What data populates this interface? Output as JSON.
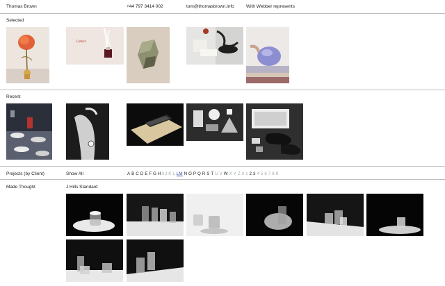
{
  "header": {
    "name": "Thomas Brown",
    "phone": "+44 797 3414 002",
    "email": "tom@thomasbrown.info",
    "rep": "With Webber represents"
  },
  "sections": {
    "selected": "Selected",
    "recent": "Recent",
    "projects": "Projects (by Client)",
    "show_all": "Show All",
    "client": "Made Thought",
    "project": "J Hills Standard"
  },
  "alphabet": {
    "active": [
      "A",
      "B",
      "C",
      "D",
      "E",
      "F",
      "G",
      "H",
      "I"
    ],
    "dim1": [
      "J",
      "K",
      "L"
    ],
    "underlined": "LM",
    "active2": [
      "N",
      "O",
      "P",
      "Q",
      "R",
      "S",
      "T"
    ],
    "dim2": [
      "U",
      "V"
    ],
    "active3": [
      "W"
    ],
    "dim3": [
      "X",
      "Y",
      "Z"
    ],
    "dim4": [
      "0",
      "1"
    ],
    "digits_dark": [
      "2",
      "3"
    ],
    "digits_dim": [
      "4",
      "5",
      "6",
      "7",
      "8",
      "9"
    ]
  },
  "images": {
    "selected": [
      "flower-vase",
      "cartier-perfume",
      "stone-sculpture",
      "objects-still-life",
      "blue-teapot"
    ],
    "recent": [
      "cafe-chairs",
      "hand-watch",
      "phone-desk",
      "geometric-shapes",
      "shoes-box"
    ],
    "project": [
      "glass-1",
      "glass-2",
      "glass-3",
      "glass-4",
      "glass-5",
      "glass-6",
      "glass-7",
      "glass-8"
    ]
  }
}
